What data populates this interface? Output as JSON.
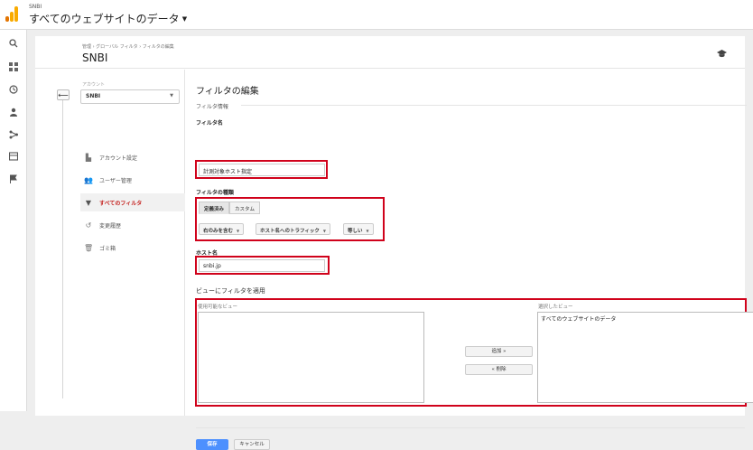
{
  "app": {
    "account_name": "SNBI",
    "view_title": "すべてのウェブサイトのデータ",
    "brand_colors": {
      "orange": "#f9ab00",
      "dark_orange": "#e37400"
    }
  },
  "leftnav": {
    "icons": [
      "search-icon",
      "dashboard-icon",
      "clock-icon",
      "person-icon",
      "share-icon",
      "table-icon",
      "flag-icon"
    ]
  },
  "header": {
    "breadcrumb": "管理 › グローバル フィルタ › フィルタの編集",
    "title": "SNBI"
  },
  "sidebar": {
    "account_label": "アカウント",
    "account_value": "SNBI",
    "items": [
      {
        "label": "アカウント設定",
        "icon": "building-icon"
      },
      {
        "label": "ユーザー管理",
        "icon": "users-icon"
      },
      {
        "label": "すべてのフィルタ",
        "icon": "filter-icon",
        "active": true
      },
      {
        "label": "変更履歴",
        "icon": "history-icon"
      },
      {
        "label": "ゴミ箱",
        "icon": "trash-icon"
      }
    ]
  },
  "form": {
    "heading": "フィルタの編集",
    "section_info": "フィルタ情報",
    "filter_name_label": "フィルタ名",
    "filter_name_value": "計測対象ホスト指定",
    "filter_type_label": "フィルタの種類",
    "tab_predefined": "定義済み",
    "tab_custom": "カスタム",
    "dd_include": "右のみを含む",
    "dd_source": "ホスト名へのトラフィック",
    "dd_match": "等しい",
    "hostname_label": "ホスト名",
    "hostname_value": "snbi.jp",
    "apply_heading": "ビューにフィルタを適用",
    "available_label": "使用可能なビュー",
    "selected_label": "選択したビュー",
    "selected_views": [
      "すべてのウェブサイトのデータ"
    ],
    "add_button": "追加 »",
    "remove_button": "« 削除",
    "save_button": "保存",
    "cancel_button": "キャンセル"
  }
}
